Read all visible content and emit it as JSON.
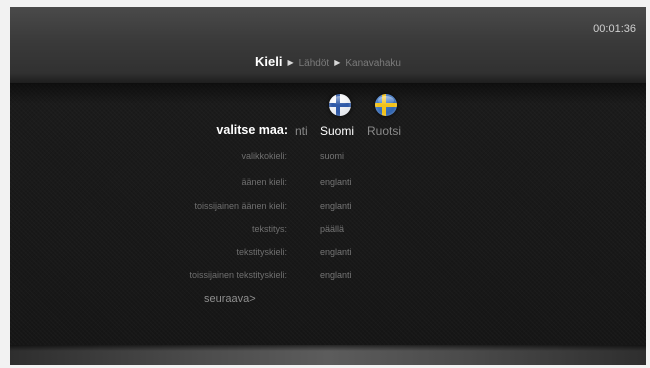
{
  "header": {
    "clock": "00:01:36",
    "breadcrumb": {
      "current": "Kieli",
      "next1": "Lähdöt",
      "next2": "Kanavahaku",
      "separator_icon": "play-arrow-icon"
    }
  },
  "country_selector": {
    "label": "valitse maa:",
    "options": [
      {
        "label": "nti",
        "state": "partial"
      },
      {
        "label": "Suomi",
        "state": "selected",
        "flag_icon": "finland-flag-icon"
      },
      {
        "label": "Ruotsi",
        "state": "unselected",
        "flag_icon": "sweden-flag-icon"
      }
    ]
  },
  "settings": [
    {
      "label": "valikkokieli:",
      "value": "suomi"
    },
    {
      "label": "äänen kieli:",
      "value": "englanti"
    },
    {
      "label": "toissijainen äänen kieli:",
      "value": "englanti"
    },
    {
      "label": "tekstitys:",
      "value": "päällä"
    },
    {
      "label": "tekstityskieli:",
      "value": "englanti"
    },
    {
      "label": "toissijainen tekstityskieli:",
      "value": "englanti"
    }
  ],
  "next_label": "seuraava>",
  "colors": {
    "background": "#1b1b1b",
    "highlight_text": "#ffffff",
    "dim_text": "#757575",
    "finland_blue": "#2f5aa8",
    "sweden_blue": "#1d4f9b",
    "sweden_yellow": "#f2c21a"
  }
}
